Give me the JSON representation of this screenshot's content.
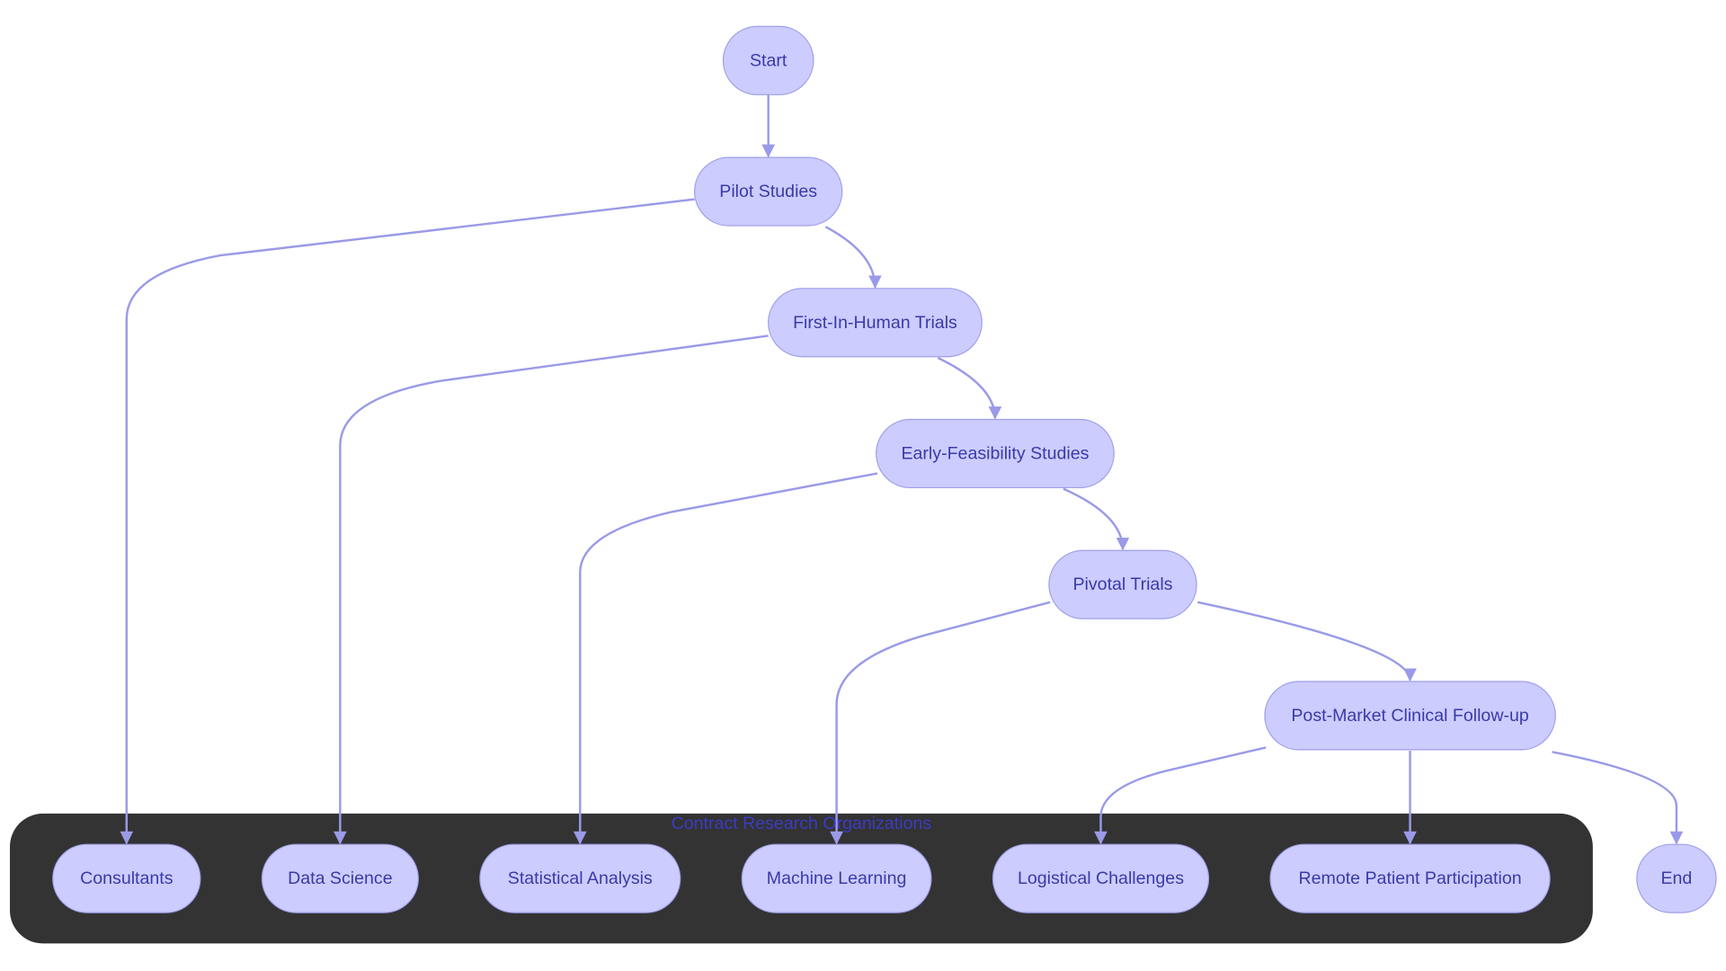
{
  "cluster": {
    "label": "Contract Research Organizations",
    "fill": "#333333"
  },
  "colors": {
    "node_fill": "#ccccff",
    "node_stroke": "#9f9fea",
    "edge": "#9a9ae8",
    "text": "#3a3aa8"
  },
  "nodes": {
    "start": "Start",
    "pilot": "Pilot Studies",
    "fih": "First-In-Human Trials",
    "efs": "Early-Feasibility Studies",
    "pivotal": "Pivotal Trials",
    "pmcf": "Post-Market Clinical Follow-up",
    "consultants": "Consultants",
    "datasci": "Data Science",
    "stat": "Statistical Analysis",
    "ml": "Machine Learning",
    "logistic": "Logistical Challenges",
    "remote": "Remote Patient Participation",
    "end": "End"
  },
  "edges": [
    [
      "Start",
      "Pilot Studies"
    ],
    [
      "Pilot Studies",
      "First-In-Human Trials"
    ],
    [
      "Pilot Studies",
      "Consultants"
    ],
    [
      "First-In-Human Trials",
      "Data Science"
    ],
    [
      "First-In-Human Trials",
      "Early-Feasibility Studies"
    ],
    [
      "Early-Feasibility Studies",
      "Statistical Analysis"
    ],
    [
      "Early-Feasibility Studies",
      "Pivotal Trials"
    ],
    [
      "Pivotal Trials",
      "Machine Learning"
    ],
    [
      "Pivotal Trials",
      "Post-Market Clinical Follow-up"
    ],
    [
      "Post-Market Clinical Follow-up",
      "Logistical Challenges"
    ],
    [
      "Post-Market Clinical Follow-up",
      "Remote Patient Participation"
    ],
    [
      "Post-Market Clinical Follow-up",
      "End"
    ]
  ]
}
